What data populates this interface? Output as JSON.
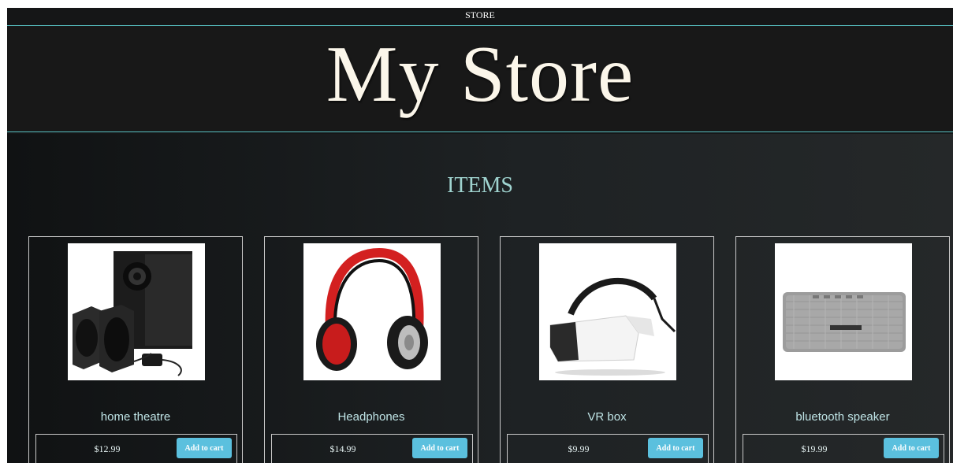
{
  "topbar": {
    "label": "STORE"
  },
  "header": {
    "title": "My Store"
  },
  "section": {
    "title": "ITEMS"
  },
  "colors": {
    "background": "#151617",
    "accent_line": "#58c2c4",
    "title_text": "#fbf6ea",
    "section_title": "#9fd3cf",
    "item_name": "#bfe4e6",
    "button": "#5bc0de"
  },
  "products": [
    {
      "name": "home theatre",
      "price": "$12.99",
      "button_label": "Add to cart",
      "image_icon": "speaker-system-icon"
    },
    {
      "name": "Headphones",
      "price": "$14.99",
      "button_label": "Add to cart",
      "image_icon": "headphones-icon"
    },
    {
      "name": "VR box",
      "price": "$9.99",
      "button_label": "Add to cart",
      "image_icon": "vr-headset-icon"
    },
    {
      "name": "bluetooth speaker",
      "price": "$19.99",
      "button_label": "Add to cart",
      "image_icon": "bluetooth-speaker-icon"
    }
  ]
}
